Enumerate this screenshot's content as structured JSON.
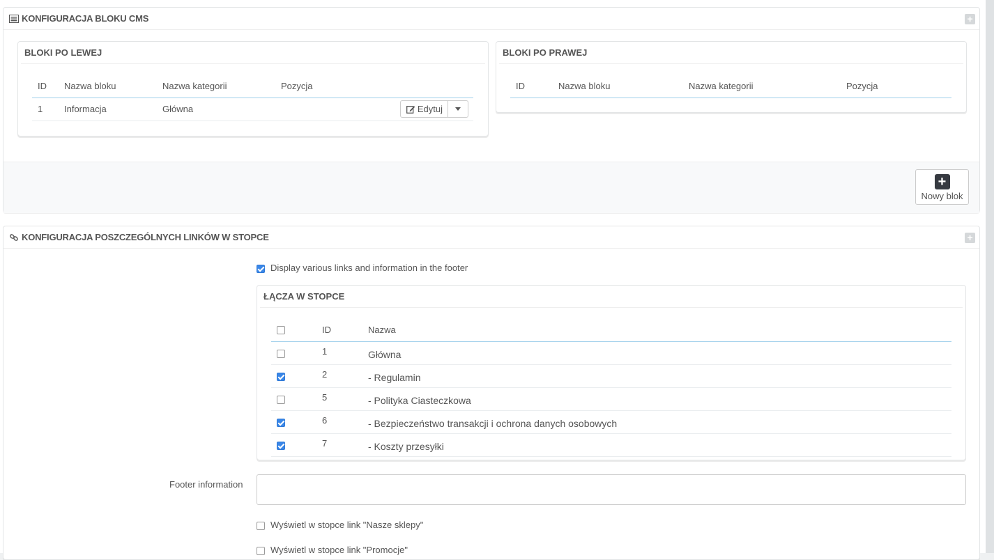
{
  "cms_panel": {
    "title": "KONFIGURACJA BLOKU CMS",
    "left": {
      "title": "BLOKI PO LEWEJ",
      "columns": [
        "ID",
        "Nazwa bloku",
        "Nazwa kategorii",
        "Pozycja"
      ],
      "rows": [
        {
          "id": "1",
          "name": "Informacja",
          "category": "Główna",
          "position": ""
        }
      ],
      "edit_label": "Edytuj"
    },
    "right": {
      "title": "BLOKI PO PRAWEJ",
      "columns": [
        "ID",
        "Nazwa bloku",
        "Nazwa kategorii",
        "Pozycja"
      ]
    },
    "new_block_label": "Nowy blok"
  },
  "links_panel": {
    "title": "KONFIGURACJA POSZCZEGÓLNYCH LINKÓW W STOPCE",
    "display_links_label": "Display various links and information in the footer",
    "display_links_checked": true,
    "links_table": {
      "title": "ŁĄCZA W STOPCE",
      "columns": [
        "ID",
        "Nazwa"
      ],
      "rows": [
        {
          "id": "1",
          "name": "Główna",
          "checked": false
        },
        {
          "id": "2",
          "name": "- Regulamin",
          "checked": true
        },
        {
          "id": "5",
          "name": "- Polityka Ciasteczkowa",
          "checked": false
        },
        {
          "id": "6",
          "name": "- Bezpieczeństwo transakcji i ochrona danych osobowych",
          "checked": true
        },
        {
          "id": "7",
          "name": "- Koszty przesyłki",
          "checked": true
        }
      ]
    },
    "footer_info_label": "Footer information",
    "footer_info_value": "",
    "option_stores_label": "Wyświetl w stopce link \"Nasze sklepy\"",
    "option_promo_label": "Wyświetl w stopce link \"Promocje\""
  }
}
